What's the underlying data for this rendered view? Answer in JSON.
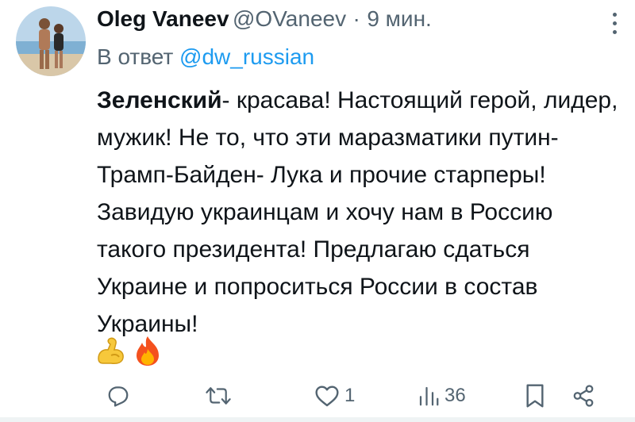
{
  "tweet": {
    "author_name": "Oleg Vaneev",
    "handle": "@OVaneev",
    "separator": "·",
    "time": "9 мин.",
    "reply_prefix": "В ответ",
    "reply_mention": "@dw_russian",
    "text_bold": "Зеленский",
    "text_rest": "- красава! Настоящий герой, лидер, мужик! Не то, что эти маразматики путин- Трамп-Байден- Лука и прочие старперы! Завидую украинцам и хочу нам в Россию такого президента! Предлагаю сдаться Украине и попроситься России в состав Украины!",
    "emojis": [
      "flexed-biceps",
      "fire"
    ]
  },
  "actions": {
    "reply_count": "",
    "retweet_count": "",
    "like_count": "1",
    "views_count": "36"
  },
  "colors": {
    "text": "#0f1419",
    "secondary": "#536471",
    "link": "#1d9bf0"
  }
}
